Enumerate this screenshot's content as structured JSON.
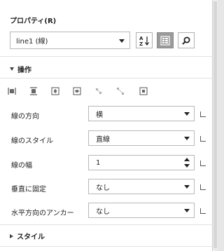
{
  "panel": {
    "title": "プロパティ(R)",
    "selected_object": "line1 (線)",
    "toolbar": {
      "sort_icon": "sort-az-icon",
      "category_icon": "category-view-icon",
      "search_icon": "search-icon"
    }
  },
  "sections": {
    "operation": {
      "label": "操作",
      "expanded": true
    },
    "style": {
      "label": "スタイル",
      "expanded": false
    }
  },
  "align_icons": [
    "align-left-icon",
    "align-center-icon",
    "align-middle-icon",
    "align-right-icon",
    "align-top-icon",
    "align-bottom-icon",
    "align-center-page-icon"
  ],
  "properties": [
    {
      "label": "線の方向",
      "value": "横",
      "control": "select"
    },
    {
      "label": "線のスタイル",
      "value": "直線",
      "control": "select"
    },
    {
      "label": "線の幅",
      "value": "1",
      "control": "spinner"
    },
    {
      "label": "垂直に固定",
      "value": "なし",
      "control": "select"
    },
    {
      "label": "水平方向のアンカー",
      "value": "なし",
      "control": "select"
    }
  ],
  "colors": {
    "active_button": "#9b9b9b",
    "border": "#b8b8b8"
  }
}
